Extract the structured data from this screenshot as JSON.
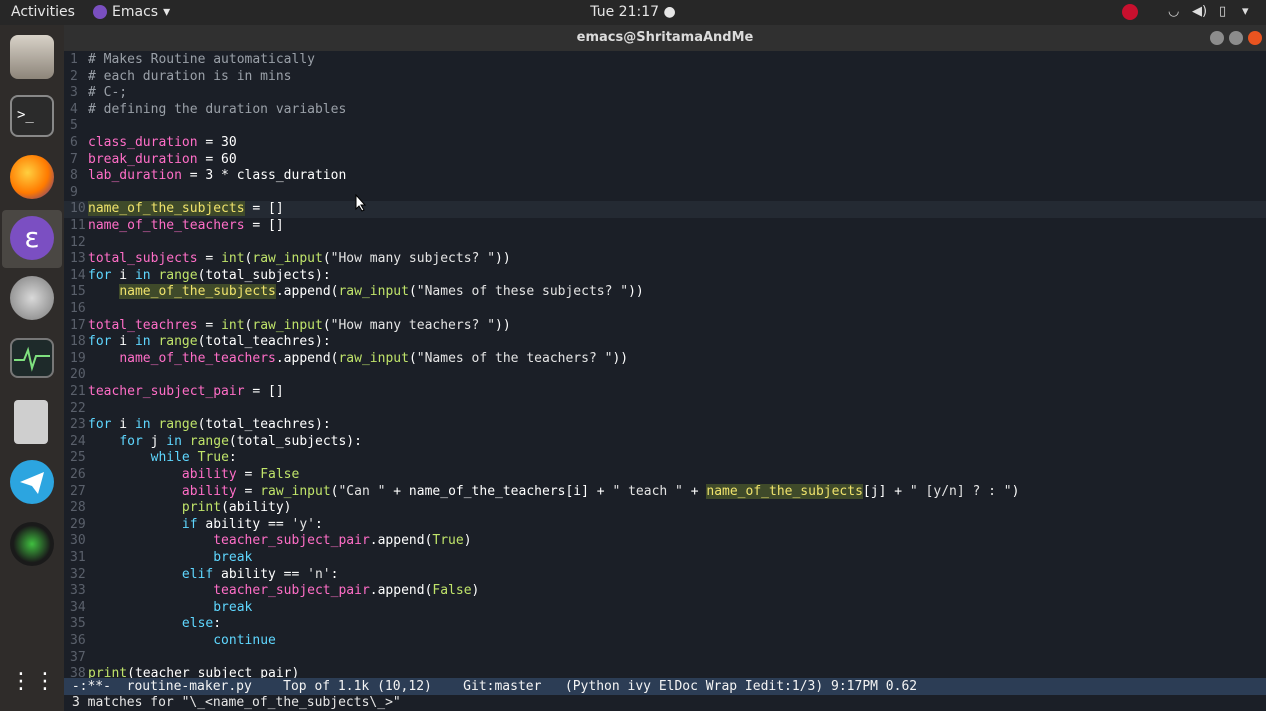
{
  "topbar": {
    "activities": "Activities",
    "app_name": "Emacs",
    "clock": "Tue 21:17",
    "tray_icons": [
      "record-icon",
      "wifi-icon",
      "volume-icon",
      "battery-icon",
      "menu-arrow-icon"
    ]
  },
  "window": {
    "title": "emacs@ShritamaAndMe"
  },
  "dock": {
    "items": [
      "files-icon",
      "terminal-icon",
      "firefox-icon",
      "emacs-icon",
      "settings-icon",
      "system-monitor-icon",
      "calculator-icon",
      "telegram-icon",
      "camera-icon",
      "app-grid-icon"
    ]
  },
  "editor": {
    "lines": [
      {
        "n": "1",
        "code": "# Makes Routine automatically"
      },
      {
        "n": "2",
        "code": "# each duration is in mins"
      },
      {
        "n": "3",
        "code": "# C-;"
      },
      {
        "n": "4",
        "code": "# defining the duration variables"
      },
      {
        "n": "5",
        "code": ""
      },
      {
        "n": "6",
        "code": "class_duration = 30"
      },
      {
        "n": "7",
        "code": "break_duration = 60"
      },
      {
        "n": "8",
        "code": "lab_duration = 3 * class_duration"
      },
      {
        "n": "9",
        "code": ""
      },
      {
        "n": "10",
        "code": "name_of_the_subjects = []"
      },
      {
        "n": "11",
        "code": "name_of_the_teachers = []"
      },
      {
        "n": "12",
        "code": ""
      },
      {
        "n": "13",
        "code": "total_subjects = int(raw_input(\"How many subjects? \"))"
      },
      {
        "n": "14",
        "code": "for i in range(total_subjects):"
      },
      {
        "n": "15",
        "code": "    name_of_the_subjects.append(raw_input(\"Names of these subjects? \"))"
      },
      {
        "n": "16",
        "code": ""
      },
      {
        "n": "17",
        "code": "total_teachres = int(raw_input(\"How many teachers? \"))"
      },
      {
        "n": "18",
        "code": "for i in range(total_teachres):"
      },
      {
        "n": "19",
        "code": "    name_of_the_teachers.append(raw_input(\"Names of the teachers? \"))"
      },
      {
        "n": "20",
        "code": ""
      },
      {
        "n": "21",
        "code": "teacher_subject_pair = []"
      },
      {
        "n": "22",
        "code": ""
      },
      {
        "n": "23",
        "code": "for i in range(total_teachres):"
      },
      {
        "n": "24",
        "code": "    for j in range(total_subjects):"
      },
      {
        "n": "25",
        "code": "        while True:"
      },
      {
        "n": "26",
        "code": "            ability = False"
      },
      {
        "n": "27",
        "code": "            ability = raw_input(\"Can \" + name_of_the_teachers[i] + \" teach \" + name_of_the_subjects[j] + \" [y/n] ? : \")"
      },
      {
        "n": "28",
        "code": "            print(ability)"
      },
      {
        "n": "29",
        "code": "            if ability == 'y':"
      },
      {
        "n": "30",
        "code": "                teacher_subject_pair.append(True)"
      },
      {
        "n": "31",
        "code": "                break"
      },
      {
        "n": "32",
        "code": "            elif ability == 'n':"
      },
      {
        "n": "33",
        "code": "                teacher_subject_pair.append(False)"
      },
      {
        "n": "34",
        "code": "                break"
      },
      {
        "n": "35",
        "code": "            else:"
      },
      {
        "n": "36",
        "code": "                continue"
      },
      {
        "n": "37",
        "code": ""
      },
      {
        "n": "38",
        "code": "print(teacher_subject_pair)"
      }
    ]
  },
  "modeline": {
    "text": " -:**-  routine-maker.py    Top of 1.1k (10,12)    Git:master   (Python ivy ElDoc Wrap Iedit:1/3) 9:17PM 0.62"
  },
  "minibuffer": {
    "text": "3 matches for \"\\_<name_of_the_subjects\\_>\""
  },
  "colors": {
    "background": "#1b1f27",
    "modeline": "#2c3d55",
    "variable": "#ff6ec7",
    "keyword": "#5fd7ff",
    "builtin": "#c0e46a",
    "match_highlight": "#f0e36c"
  }
}
